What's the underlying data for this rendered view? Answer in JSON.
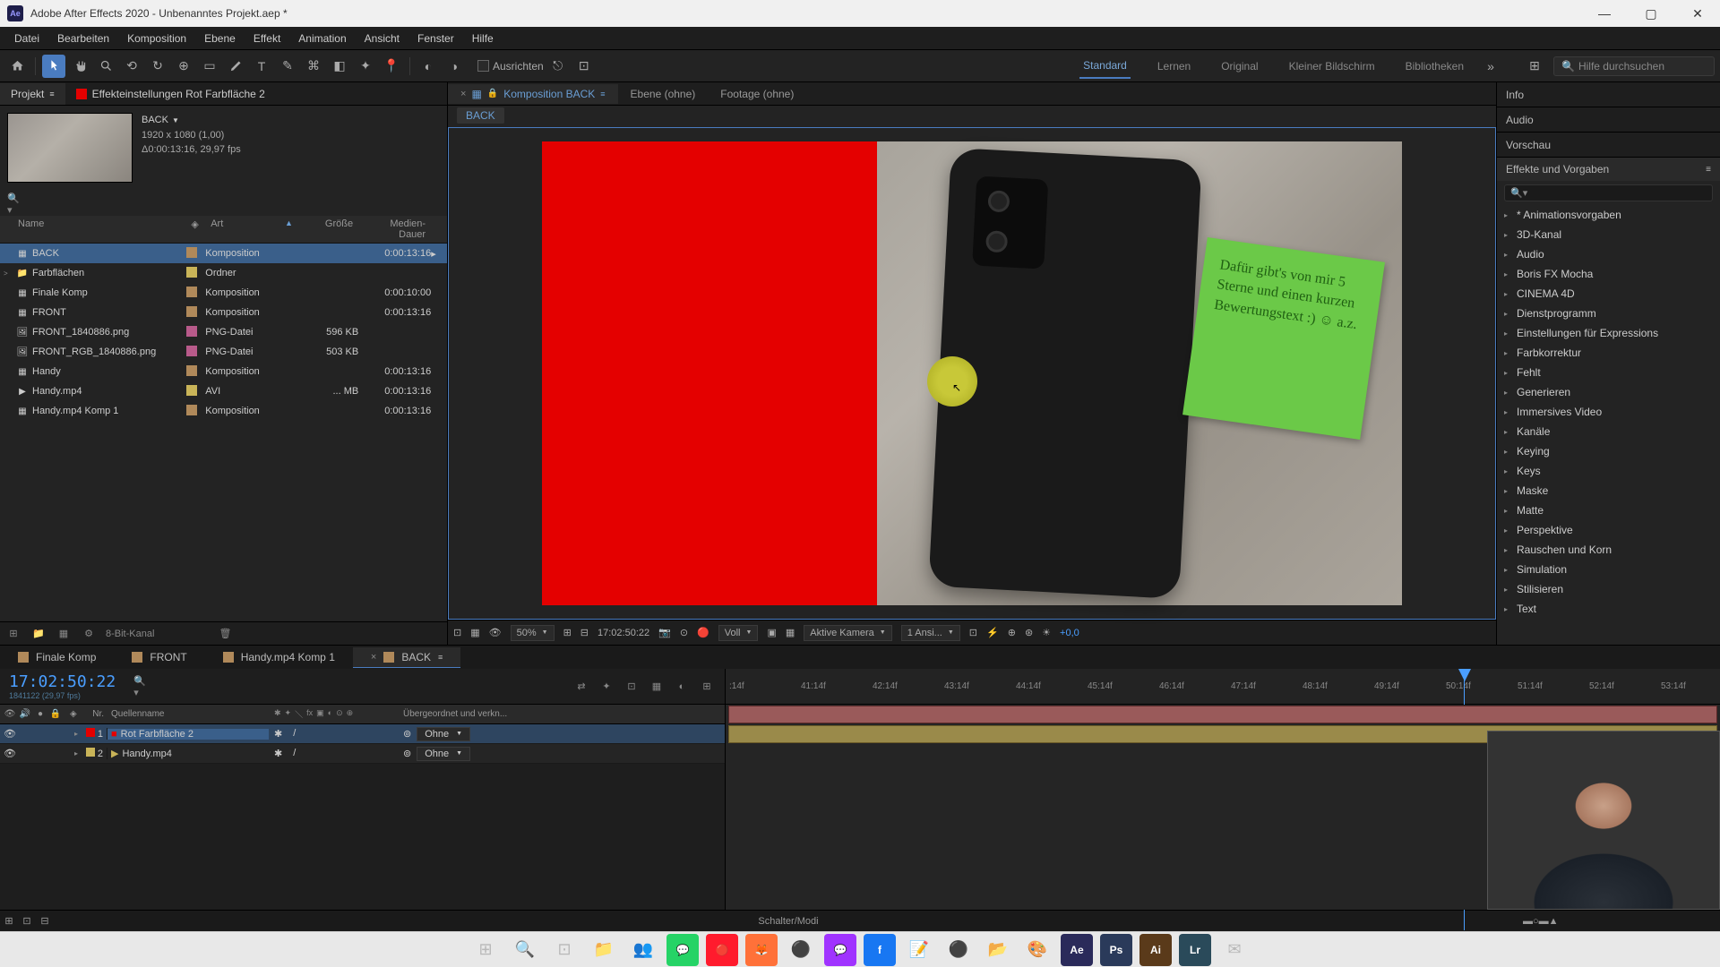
{
  "titlebar": {
    "app": "Adobe After Effects 2020",
    "project": "Unbenanntes Projekt.aep *"
  },
  "menu": [
    "Datei",
    "Bearbeiten",
    "Komposition",
    "Ebene",
    "Effekt",
    "Animation",
    "Ansicht",
    "Fenster",
    "Hilfe"
  ],
  "toolbar": {
    "align_label": "Ausrichten",
    "workspaces": [
      "Standard",
      "Lernen",
      "Original",
      "Kleiner Bildschirm",
      "Bibliotheken"
    ],
    "active_workspace": "Standard",
    "search_placeholder": "Hilfe durchsuchen"
  },
  "project_panel": {
    "tab1": "Projekt",
    "tab2": "Effekteinstellungen Rot Farbfläche 2",
    "comp_name": "BACK",
    "resolution": "1920 x 1080 (1,00)",
    "duration": "Δ0:00:13:16, 29,97 fps",
    "headers": {
      "name": "Name",
      "art": "Art",
      "size": "Größe",
      "duration": "Medien-Dauer"
    },
    "items": [
      {
        "name": "BACK",
        "art": "Komposition",
        "size": "",
        "dur": "0:00:13:16",
        "icon": "comp",
        "label": "#b0895a",
        "selected": true,
        "end": "▸"
      },
      {
        "name": "Farbflächen",
        "art": "Ordner",
        "size": "",
        "dur": "",
        "icon": "folder",
        "label": "#c9b458",
        "expand": ">"
      },
      {
        "name": "Finale Komp",
        "art": "Komposition",
        "size": "",
        "dur": "0:00:10:00",
        "icon": "comp",
        "label": "#b0895a"
      },
      {
        "name": "FRONT",
        "art": "Komposition",
        "size": "",
        "dur": "0:00:13:16",
        "icon": "comp",
        "label": "#b0895a"
      },
      {
        "name": "FRONT_1840886.png",
        "art": "PNG-Datei",
        "size": "596 KB",
        "dur": "",
        "icon": "png",
        "label": "#b85a8a"
      },
      {
        "name": "FRONT_RGB_1840886.png",
        "art": "PNG-Datei",
        "size": "503 KB",
        "dur": "",
        "icon": "png",
        "label": "#b85a8a"
      },
      {
        "name": "Handy",
        "art": "Komposition",
        "size": "",
        "dur": "0:00:13:16",
        "icon": "comp",
        "label": "#b0895a"
      },
      {
        "name": "Handy.mp4",
        "art": "AVI",
        "size": "... MB",
        "dur": "0:00:13:16",
        "icon": "mov",
        "label": "#c9b458"
      },
      {
        "name": "Handy.mp4 Komp 1",
        "art": "Komposition",
        "size": "",
        "dur": "0:00:13:16",
        "icon": "comp",
        "label": "#b0895a"
      }
    ],
    "footer_bits": "8-Bit-Kanal"
  },
  "comp_panel": {
    "tabs": [
      {
        "label": "Komposition BACK",
        "active": true,
        "prefix": true
      },
      {
        "label": "Ebene (ohne)"
      },
      {
        "label": "Footage (ohne)"
      }
    ],
    "breadcrumb": "BACK",
    "sticky_note_text": "Dafür gibt's von mir 5 Sterne und einen kurzen Bewertungstext :) ☺ a.z.",
    "footer": {
      "zoom": "50%",
      "timecode": "17:02:50:22",
      "resolution": "Voll",
      "camera": "Aktive Kamera",
      "views": "1 Ansi...",
      "exposure": "+0,0"
    }
  },
  "right_panels": {
    "tabs": [
      "Info",
      "Audio",
      "Vorschau"
    ],
    "effects_title": "Effekte und Vorgaben",
    "categories": [
      "* Animationsvorgaben",
      "3D-Kanal",
      "Audio",
      "Boris FX Mocha",
      "CINEMA 4D",
      "Dienstprogramm",
      "Einstellungen für Expressions",
      "Farbkorrektur",
      "Fehlt",
      "Generieren",
      "Immersives Video",
      "Kanäle",
      "Keying",
      "Keys",
      "Maske",
      "Matte",
      "Perspektive",
      "Rauschen und Korn",
      "Simulation",
      "Stilisieren",
      "Text"
    ]
  },
  "timeline": {
    "tabs": [
      {
        "label": "Finale Komp",
        "color": "#b0895a"
      },
      {
        "label": "FRONT",
        "color": "#b0895a"
      },
      {
        "label": "Handy.mp4 Komp 1",
        "color": "#b0895a"
      },
      {
        "label": "BACK",
        "color": "#b0895a",
        "active": true
      }
    ],
    "timecode": "17:02:50:22",
    "timecode_sub": "1841122 (29,97 fps)",
    "headers": {
      "nr": "Nr.",
      "name": "Quellenname",
      "parent": "Übergeordnet und verkn..."
    },
    "layers": [
      {
        "num": "1",
        "name": "Rot Farbfläche 2",
        "color": "#e40000",
        "parent": "Ohne",
        "icon": "solid",
        "selected": true
      },
      {
        "num": "2",
        "name": "Handy.mp4",
        "color": "#c9b458",
        "parent": "Ohne",
        "icon": "mov"
      }
    ],
    "ruler": [
      ":14f",
      "41:14f",
      "42:14f",
      "43:14f",
      "44:14f",
      "45:14f",
      "46:14f",
      "47:14f",
      "48:14f",
      "49:14f",
      "50:14f",
      "51:14f",
      "52:14f",
      "53:14f"
    ],
    "footer_label": "Schalter/Modi"
  },
  "taskbar_icons": [
    "windows",
    "search",
    "taskview",
    "explorer",
    "teams",
    "whatsapp",
    "opera",
    "firefox",
    "app1",
    "messenger",
    "facebook",
    "notes",
    "obs",
    "folder",
    "paint",
    "ae",
    "ps",
    "ai",
    "lr",
    "mail"
  ]
}
